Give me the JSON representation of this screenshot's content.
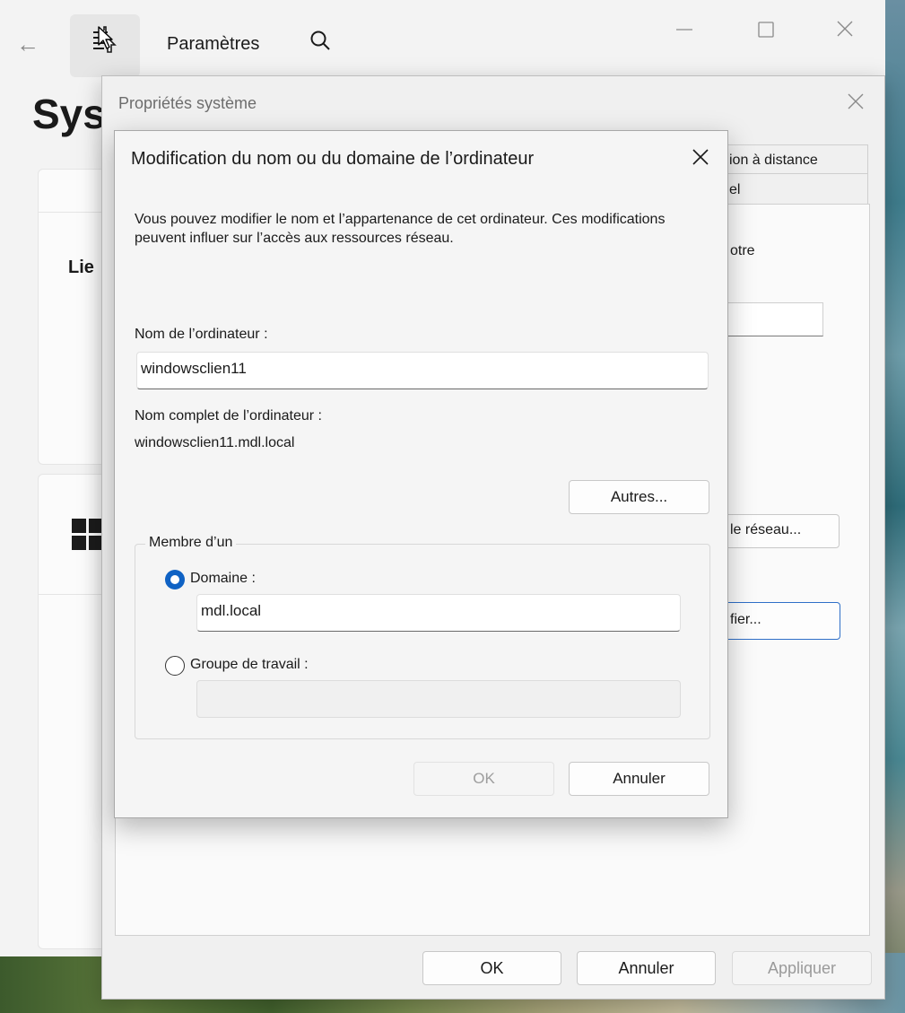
{
  "settings": {
    "title": "Paramètres",
    "page_heading_fragment": "Sys",
    "card_label_fragment": "Lie",
    "icons": [
      "back-arrow-icon",
      "search-icon",
      "minimize-icon",
      "maximize-icon",
      "close-icon",
      "windows-logo-icon"
    ]
  },
  "system_properties": {
    "title": "Propriétés système",
    "tab_fragment_1": "ion à distance",
    "tab_fragment_2": "el",
    "text_fragment": "otre",
    "network_button_fragment": "le réseau...",
    "modify_button_fragment": "fier...",
    "ok_label": "OK",
    "cancel_label": "Annuler",
    "apply_label": "Appliquer"
  },
  "rename_dialog": {
    "title": "Modification du nom ou du domaine de l’ordinateur",
    "description": "Vous pouvez modifier le nom et l’appartenance de cet ordinateur. Ces modifications peuvent influer sur l’accès aux ressources réseau.",
    "computer_name_label": "Nom de l’ordinateur :",
    "computer_name_value": "windowsclien11",
    "full_name_label": "Nom complet de l’ordinateur :",
    "full_name_value": "windowsclien11.mdl.local",
    "more_button": "Autres...",
    "member_of_label": "Membre d’un",
    "domain_label": "Domaine :",
    "domain_value": "mdl.local",
    "domain_selected": true,
    "workgroup_label": "Groupe de travail :",
    "workgroup_value": "",
    "ok_label": "OK",
    "cancel_label": "Annuler"
  },
  "colors": {
    "accent": "#0f62c4",
    "focus_border": "#2f6fc8",
    "window_bg": "#f3f3f3"
  }
}
